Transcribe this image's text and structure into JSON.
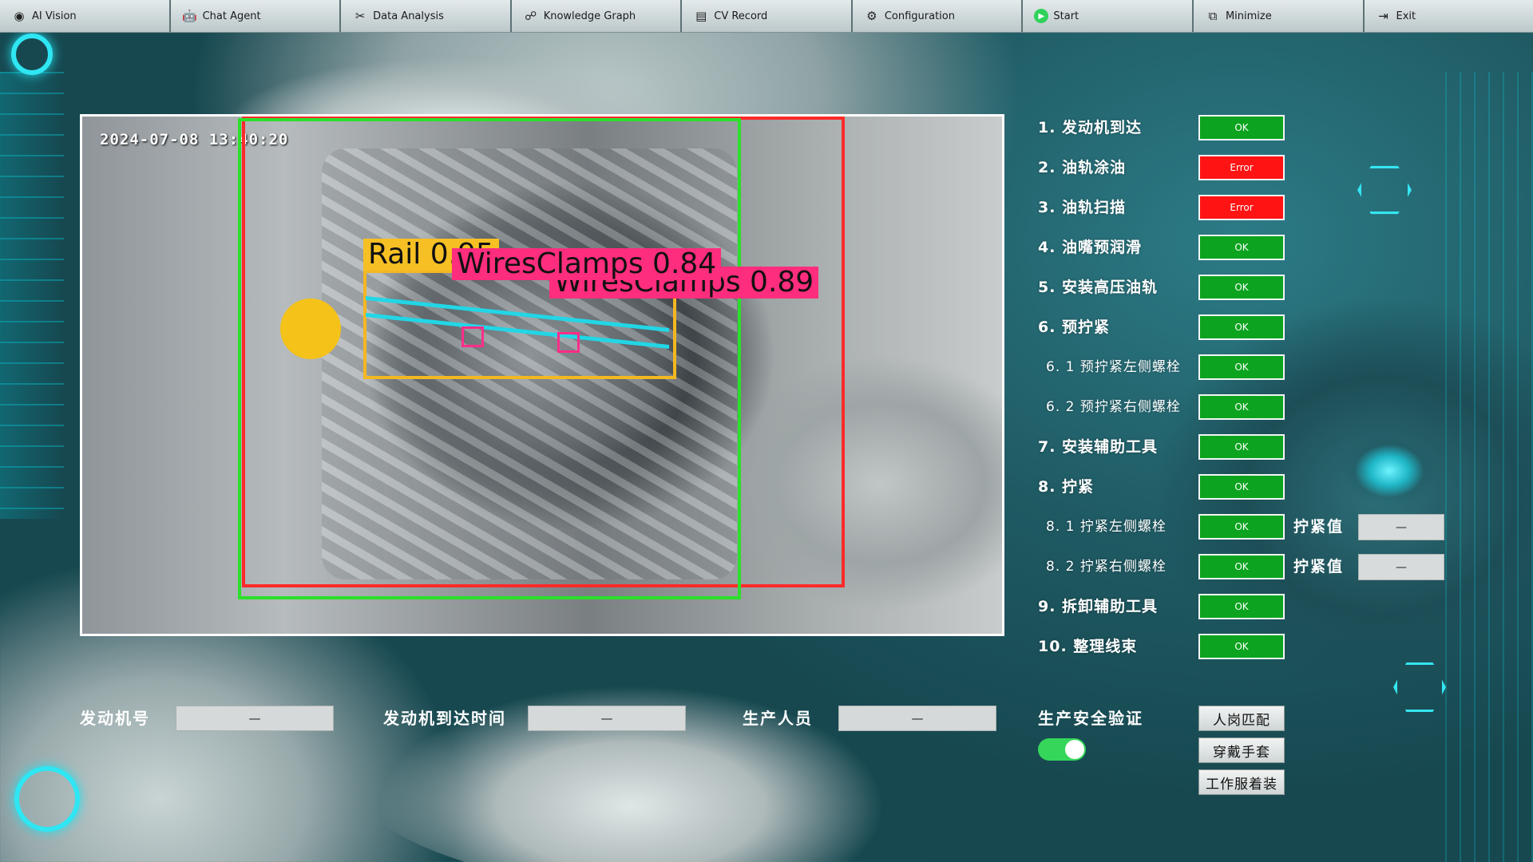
{
  "nav": [
    {
      "label": "AI Vision",
      "icon": "eye-icon"
    },
    {
      "label": "Chat Agent",
      "icon": "robot-icon"
    },
    {
      "label": "Data Analysis",
      "icon": "tools-icon"
    },
    {
      "label": "Knowledge Graph",
      "icon": "graph-icon"
    },
    {
      "label": "CV Record",
      "icon": "database-icon"
    },
    {
      "label": "Configuration",
      "icon": "gear-icon"
    },
    {
      "label": "Start",
      "icon": "play-icon"
    },
    {
      "label": "Minimize",
      "icon": "minimize-icon"
    },
    {
      "label": "Exit",
      "icon": "exit-icon"
    }
  ],
  "camera": {
    "timestamp": "2024-07-08 13:40:20",
    "detections": [
      {
        "label": "Rail 0.95",
        "color": "#f6c024"
      },
      {
        "label": "WiresClamps 0.84",
        "color": "#ff2d7d"
      },
      {
        "label": "WiresClamps 0.89",
        "color": "#ff2d7d"
      }
    ]
  },
  "steps": [
    {
      "label": "1. 发动机到达",
      "status": "OK"
    },
    {
      "label": "2. 油轨涂油",
      "status": "Error"
    },
    {
      "label": "3. 油轨扫描",
      "status": "Error"
    },
    {
      "label": "4. 油嘴预润滑",
      "status": "OK"
    },
    {
      "label": "5. 安装高压油轨",
      "status": "OK"
    },
    {
      "label": "6. 预拧紧",
      "status": "OK"
    },
    {
      "label": "6. 1  预拧紧左侧螺栓",
      "status": "OK"
    },
    {
      "label": "6. 2  预拧紧右侧螺栓",
      "status": "OK"
    },
    {
      "label": "7. 安装辅助工具",
      "status": "OK"
    },
    {
      "label": "8. 拧紧",
      "status": "OK"
    },
    {
      "label": "8. 1  拧紧左侧螺栓",
      "status": "OK"
    },
    {
      "label": "8. 2  拧紧右侧螺栓",
      "status": "OK"
    },
    {
      "label": "9. 拆卸辅助工具",
      "status": "OK"
    },
    {
      "label": "10. 整理线束",
      "status": "OK"
    }
  ],
  "torque": [
    {
      "label": "拧紧值",
      "value": "—"
    },
    {
      "label": "拧紧值",
      "value": "—"
    }
  ],
  "info": {
    "engine_no_label": "发动机号",
    "engine_no_value": "—",
    "arrival_time_label": "发动机到达时间",
    "arrival_time_value": "—",
    "operator_label": "生产人员",
    "operator_value": "—"
  },
  "safety": {
    "label": "生产安全验证",
    "buttons": [
      "人岗匹配",
      "穿戴手套",
      "工作服着装"
    ]
  },
  "colors": {
    "ok": "#0ca31e",
    "error": "#ff1313",
    "accent": "#2fe6f3"
  }
}
